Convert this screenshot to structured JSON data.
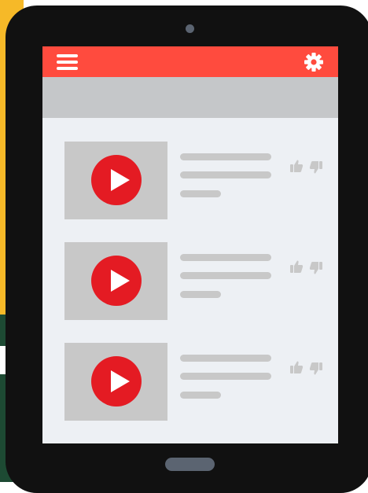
{
  "screen": {
    "topbar": {
      "color": "#ff4b3e",
      "left_icon": "hamburger-menu-icon",
      "right_icon": "gear-icon"
    },
    "subbar_color": "#c5c7c9",
    "background_color": "#edf0f4"
  },
  "videos": [
    {
      "thumbnail_icon": "play-icon",
      "play_color": "#e41b23",
      "actions": [
        "thumbs-up-icon",
        "thumbs-down-icon"
      ]
    },
    {
      "thumbnail_icon": "play-icon",
      "play_color": "#e41b23",
      "actions": [
        "thumbs-up-icon",
        "thumbs-down-icon"
      ]
    },
    {
      "thumbnail_icon": "play-icon",
      "play_color": "#e41b23",
      "actions": [
        "thumbs-up-icon",
        "thumbs-down-icon"
      ]
    }
  ],
  "device": {
    "type": "tablet",
    "frame_color": "#111111",
    "hardware_accent": "#5b6471"
  }
}
